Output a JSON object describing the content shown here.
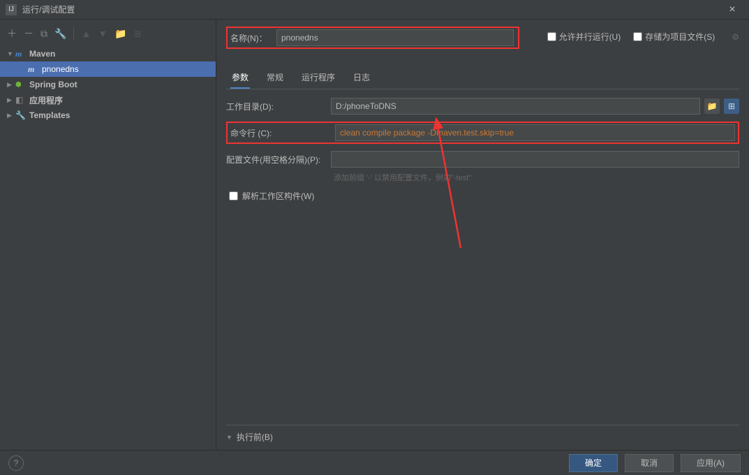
{
  "titlebar": {
    "title": "运行/调试配置"
  },
  "tree": {
    "maven": "Maven",
    "config": "pnonedns",
    "spring": "Spring Boot",
    "app": "应用程序",
    "templates": "Templates"
  },
  "header": {
    "name_label": "名称(N)：",
    "name_value": "pnonedns",
    "allow_parallel": "允许并行运行(U)",
    "store_project": "存储为项目文件(S)"
  },
  "tabs": [
    "参数",
    "常规",
    "运行程序",
    "日志"
  ],
  "form": {
    "workdir_label": "工作目录(D):",
    "workdir_value": "D:/phoneToDNS",
    "cmd_label": "命令行 (C):",
    "cmd_value": "clean compile package -Dmaven.test.skip=true",
    "profiles_label": "配置文件(用空格分隔)(P):",
    "profiles_value": "",
    "profiles_hint": "添加前缀 '-' 以禁用配置文件，例如\"-test\"",
    "resolve_label": "解析工作区构件(W)"
  },
  "before": {
    "label": "执行前(B)"
  },
  "footer": {
    "ok": "确定",
    "cancel": "取消",
    "apply": "应用(A)"
  }
}
